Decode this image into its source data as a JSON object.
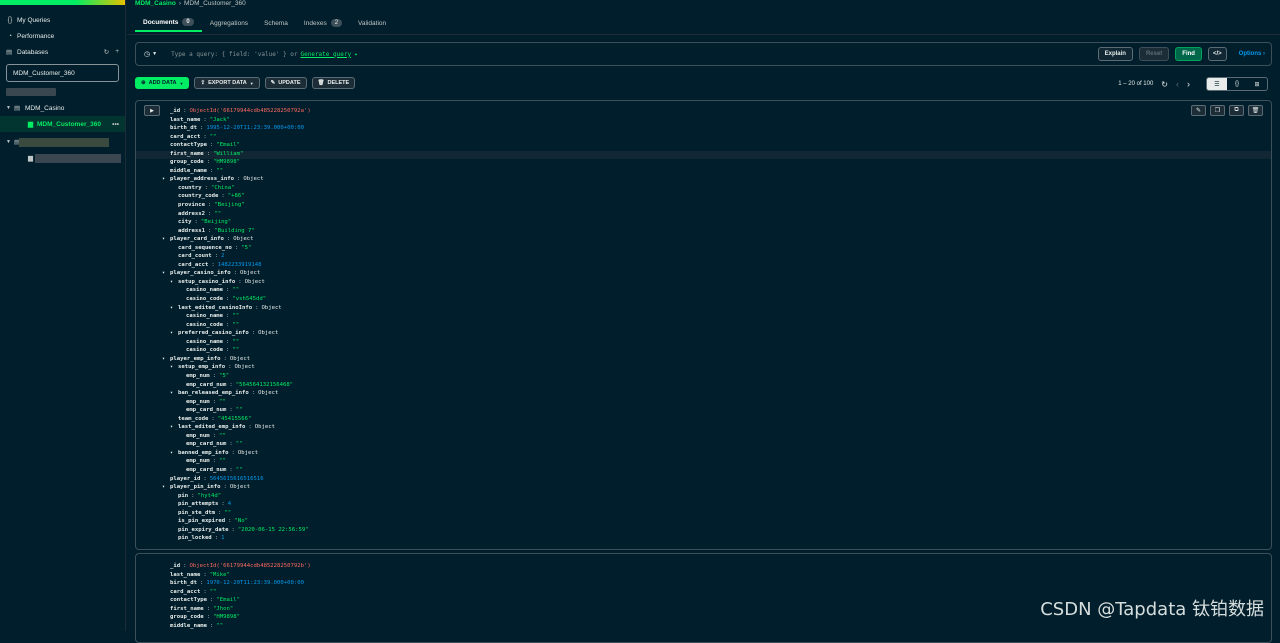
{
  "sidebar": {
    "my_queries": "My Queries",
    "performance": "Performance",
    "databases": "Databases",
    "search_value": "MDM_Customer_360",
    "tree": {
      "db": "MDM_Casino",
      "collection": "MDM_Customer_360"
    }
  },
  "breadcrumb": {
    "db": "MDM_Casino",
    "collection": "MDM_Customer_360"
  },
  "tabs": [
    {
      "label": "Documents",
      "badge": "0"
    },
    {
      "label": "Aggregations"
    },
    {
      "label": "Schema"
    },
    {
      "label": "Indexes",
      "badge": "2"
    },
    {
      "label": "Validation"
    }
  ],
  "query": {
    "placeholder_prefix": "Type a query: { field: 'value' } or",
    "generate": "Generate query",
    "explain": "Explain",
    "reset": "Reset",
    "find": "Find",
    "options": "Options ›"
  },
  "toolbar": {
    "add": "ADD DATA",
    "export": "EXPORT DATA",
    "update": "UPDATE",
    "delete": "DELETE",
    "range": "1 – 20 of 100"
  },
  "doc1": [
    {
      "i": 0,
      "k": "_id",
      "v": "ObjectId('66179944cdb485228250792a')",
      "t": "oid"
    },
    {
      "i": 0,
      "k": "last_name",
      "v": "\"Jack\"",
      "t": "s"
    },
    {
      "i": 0,
      "k": "birth_dt",
      "v": "1995-12-20T11:23:39.000+00:00",
      "t": "n"
    },
    {
      "i": 0,
      "k": "card_acct",
      "v": "\"\"",
      "t": "s"
    },
    {
      "i": 0,
      "k": "contactType",
      "v": "\"Email\"",
      "t": "s"
    },
    {
      "i": 0,
      "k": "first_name",
      "v": "\"William\"",
      "t": "s"
    },
    {
      "i": 0,
      "k": "group_code",
      "v": "\"HM9898\"",
      "t": "s"
    },
    {
      "i": 0,
      "k": "middle_name",
      "v": "\"\"",
      "t": "s"
    },
    {
      "i": 0,
      "k": "player_address_info",
      "v": "Object",
      "t": "o",
      "arr": true
    },
    {
      "i": 1,
      "k": "country",
      "v": "\"China\"",
      "t": "s"
    },
    {
      "i": 1,
      "k": "country_code",
      "v": "\"+86\"",
      "t": "s"
    },
    {
      "i": 1,
      "k": "province",
      "v": "\"Beijing\"",
      "t": "s"
    },
    {
      "i": 1,
      "k": "address2",
      "v": "\"\"",
      "t": "s"
    },
    {
      "i": 1,
      "k": "city",
      "v": "\"Beijing\"",
      "t": "s"
    },
    {
      "i": 1,
      "k": "address1",
      "v": "\"Building 7\"",
      "t": "s"
    },
    {
      "i": 0,
      "k": "player_card_info",
      "v": "Object",
      "t": "o",
      "arr": true
    },
    {
      "i": 1,
      "k": "card_sequence_no",
      "v": "\"5\"",
      "t": "s"
    },
    {
      "i": 1,
      "k": "card_count",
      "v": "2",
      "t": "n"
    },
    {
      "i": 1,
      "k": "card_acct",
      "v": "1482233919148",
      "t": "n"
    },
    {
      "i": 0,
      "k": "player_casino_info",
      "v": "Object",
      "t": "o",
      "arr": true
    },
    {
      "i": 1,
      "k": "setup_casino_info",
      "v": "Object",
      "t": "o",
      "arr": true
    },
    {
      "i": 2,
      "k": "casino_name",
      "v": "\"\"",
      "t": "s"
    },
    {
      "i": 2,
      "k": "casino_code",
      "v": "\"vsh545dd\"",
      "t": "s"
    },
    {
      "i": 1,
      "k": "last_edited_casinoInfo",
      "v": "Object",
      "t": "o",
      "arr": true
    },
    {
      "i": 2,
      "k": "casino_name",
      "v": "\"\"",
      "t": "s"
    },
    {
      "i": 2,
      "k": "casino_code",
      "v": "\"\"",
      "t": "s"
    },
    {
      "i": 1,
      "k": "preferred_casino_info",
      "v": "Object",
      "t": "o",
      "arr": true
    },
    {
      "i": 2,
      "k": "casino_name",
      "v": "\"\"",
      "t": "s"
    },
    {
      "i": 2,
      "k": "casino_code",
      "v": "\"\"",
      "t": "s"
    },
    {
      "i": 0,
      "k": "player_emp_info",
      "v": "Object",
      "t": "o",
      "arr": true
    },
    {
      "i": 1,
      "k": "setup_emp_info",
      "v": "Object",
      "t": "o",
      "arr": true
    },
    {
      "i": 2,
      "k": "emp_num",
      "v": "\"5\"",
      "t": "s"
    },
    {
      "i": 2,
      "k": "emp_card_num",
      "v": "\"564564132156468\"",
      "t": "s"
    },
    {
      "i": 1,
      "k": "ban_released_emp_info",
      "v": "Object",
      "t": "o",
      "arr": true
    },
    {
      "i": 2,
      "k": "emp_num",
      "v": "\"\"",
      "t": "s"
    },
    {
      "i": 2,
      "k": "emp_card_num",
      "v": "\"\"",
      "t": "s"
    },
    {
      "i": 1,
      "k": "team_code",
      "v": "\"45415566\"",
      "t": "s"
    },
    {
      "i": 1,
      "k": "last_edited_emp_info",
      "v": "Object",
      "t": "o",
      "arr": true
    },
    {
      "i": 2,
      "k": "emp_num",
      "v": "\"\"",
      "t": "s"
    },
    {
      "i": 2,
      "k": "emp_card_num",
      "v": "\"\"",
      "t": "s"
    },
    {
      "i": 1,
      "k": "banned_emp_info",
      "v": "Object",
      "t": "o",
      "arr": true
    },
    {
      "i": 2,
      "k": "emp_num",
      "v": "\"\"",
      "t": "s"
    },
    {
      "i": 2,
      "k": "emp_card_num",
      "v": "\"\"",
      "t": "s"
    },
    {
      "i": 0,
      "k": "player_id",
      "v": "5645615616516516",
      "t": "n"
    },
    {
      "i": 0,
      "k": "player_pin_info",
      "v": "Object",
      "t": "o",
      "arr": true
    },
    {
      "i": 1,
      "k": "pin",
      "v": "\"hyt4d\"",
      "t": "s"
    },
    {
      "i": 1,
      "k": "pin_attempts",
      "v": "4",
      "t": "n"
    },
    {
      "i": 1,
      "k": "pin_ste_dtm",
      "v": "\"\"",
      "t": "s"
    },
    {
      "i": 1,
      "k": "is_pin_expired",
      "v": "\"No\"",
      "t": "s"
    },
    {
      "i": 1,
      "k": "pin_expiry_date",
      "v": "\"2020-06-15 22:56:59\"",
      "t": "s"
    },
    {
      "i": 1,
      "k": "pin_locked",
      "v": "1",
      "t": "n"
    }
  ],
  "doc2": [
    {
      "i": 0,
      "k": "_id",
      "v": "ObjectId('66179944cdb485228250792b')",
      "t": "oid"
    },
    {
      "i": 0,
      "k": "last_name",
      "v": "\"Mike\"",
      "t": "s"
    },
    {
      "i": 0,
      "k": "birth_dt",
      "v": "1970-12-20T11:23:39.000+00:00",
      "t": "n"
    },
    {
      "i": 0,
      "k": "card_acct",
      "v": "\"\"",
      "t": "s"
    },
    {
      "i": 0,
      "k": "contactType",
      "v": "\"Email\"",
      "t": "s"
    },
    {
      "i": 0,
      "k": "first_name",
      "v": "\"Jhon\"",
      "t": "s"
    },
    {
      "i": 0,
      "k": "group_code",
      "v": "\"HM9898\"",
      "t": "s"
    },
    {
      "i": 0,
      "k": "middle_name",
      "v": "\"\"",
      "t": "s"
    }
  ],
  "watermark": "CSDN @Tapdata 钛铂数据"
}
